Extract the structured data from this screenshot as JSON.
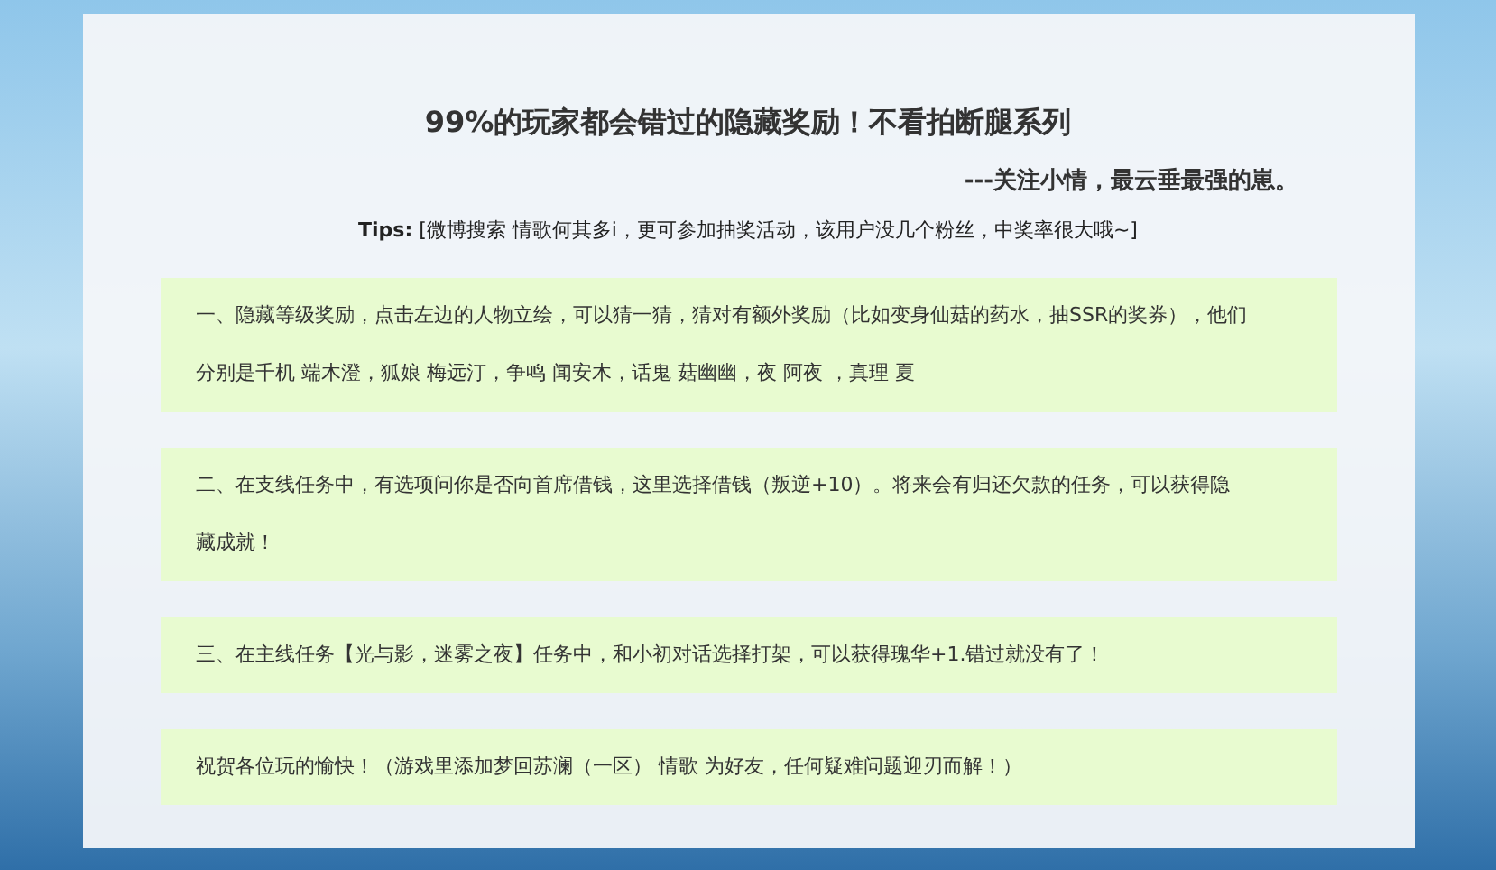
{
  "title": "99%的玩家都会错过的隐藏奖励！不看拍断腿系列",
  "subtitle": "---关注小情，最云垂最强的崽。",
  "tips": "**Tips:** [微博搜索 情歌何其多i，更可参加抽奖活动，该用户没几个粉丝，中奖率很大哦~]",
  "sections": [
    {
      "text": "一、隐藏等级奖励，点击左边的人物立绘，可以猜一猜，猜对有额外奖励（比如变身仙菇的药水，抽SSR的奖券），他们分别是千机 端木澄，狐娘 梅远汀，争鸣 闻安木，话鬼 菇幽幽，夜 阿夜 ，真理 夏"
    },
    {
      "text": "二、在支线任务中，有选项问你是否向首席借钱，这里选择借钱（叛逆+10）。将来会有归还欠款的任务，可以获得隐藏成就！"
    },
    {
      "text": "三、在主线任务【光与影，迷雾之夜】任务中，和小初对话选择打架，可以获得瑰华+1.错过就没有了！"
    },
    {
      "text": "祝贺各位玩的愉快！（游戏里添加梦回苏澜（一区） 情歌 为好友，任何疑难问题迎刃而解！）"
    }
  ]
}
